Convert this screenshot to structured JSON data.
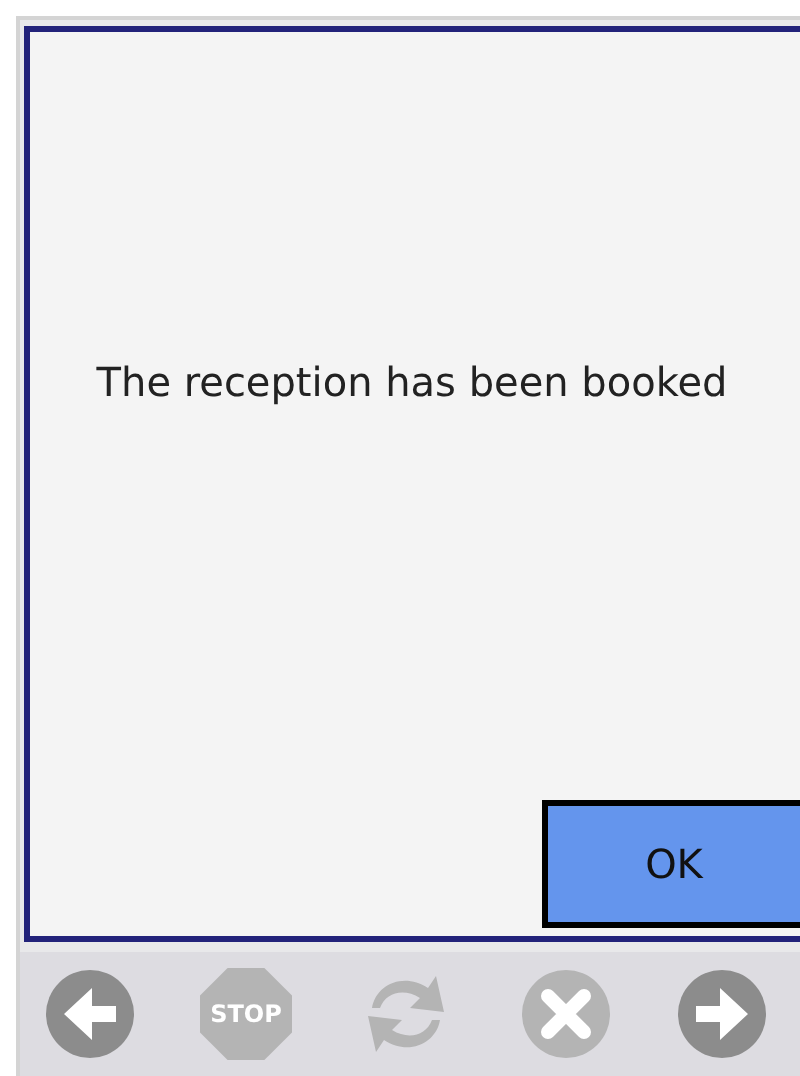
{
  "dialog": {
    "message": "The reception has been booked",
    "button": "OK"
  },
  "toolbar": [
    {
      "kind": "back",
      "disabled": false
    },
    {
      "kind": "stop",
      "label": "STOP",
      "disabled": true
    },
    {
      "kind": "refresh",
      "disabled": true
    },
    {
      "kind": "cancel",
      "disabled": true
    },
    {
      "kind": "forward",
      "disabled": false
    }
  ]
}
